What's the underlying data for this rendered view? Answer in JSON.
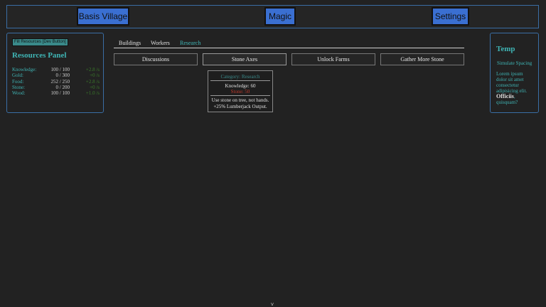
{
  "topbar": {
    "basis_village": "Basis Village",
    "magic": "Magic",
    "settings": "Settings"
  },
  "resources": {
    "dev_button": "Fill Resources [Dev Button]",
    "title": "Resources Panel",
    "rows": [
      {
        "name": "Knowledge:",
        "value": "100 / 100",
        "rate": "+2.8 /s"
      },
      {
        "name": "Gold:",
        "value": "0 / 300",
        "rate": "+0 /s"
      },
      {
        "name": "Food:",
        "value": "252 / 250",
        "rate": "+2.8 /s"
      },
      {
        "name": "Stone:",
        "value": "0 / 200",
        "rate": "+0 /s"
      },
      {
        "name": "Wood:",
        "value": "100 / 100",
        "rate": "+1.0 /s"
      }
    ]
  },
  "tabs": {
    "buildings": "Buildings",
    "workers": "Workers",
    "research": "Research"
  },
  "research_cards": {
    "discussions": "Discussions",
    "stone_axes": "Stone Axes",
    "unlock_farms": "Unlock Farms",
    "gather_more_stone": "Gather More Stone"
  },
  "tooltip": {
    "category": "Category: Research",
    "knowledge_cost": "Knowledge: 60",
    "stone_cost": "Stone: 50",
    "desc_line1": "Use stone on tree, not hands.",
    "desc_line2": "+25% Lumberjack Output."
  },
  "temp": {
    "title": "Temp",
    "simulate_spacing": "Simulate Spacing",
    "lorem_text": "Lorem ipsum dolor sit amet consectetur adipisicing elit.",
    "officiis": "Officiis",
    "quisquam": ", quisquam?"
  },
  "scroll_icon": "chevron-down-icon",
  "scroll_glyph": "v",
  "colors": {
    "accent": "#3fb5b5",
    "button_blue": "#3a6fd1",
    "rate_green": "#3a7a2a",
    "cost_red": "#c0392b"
  }
}
